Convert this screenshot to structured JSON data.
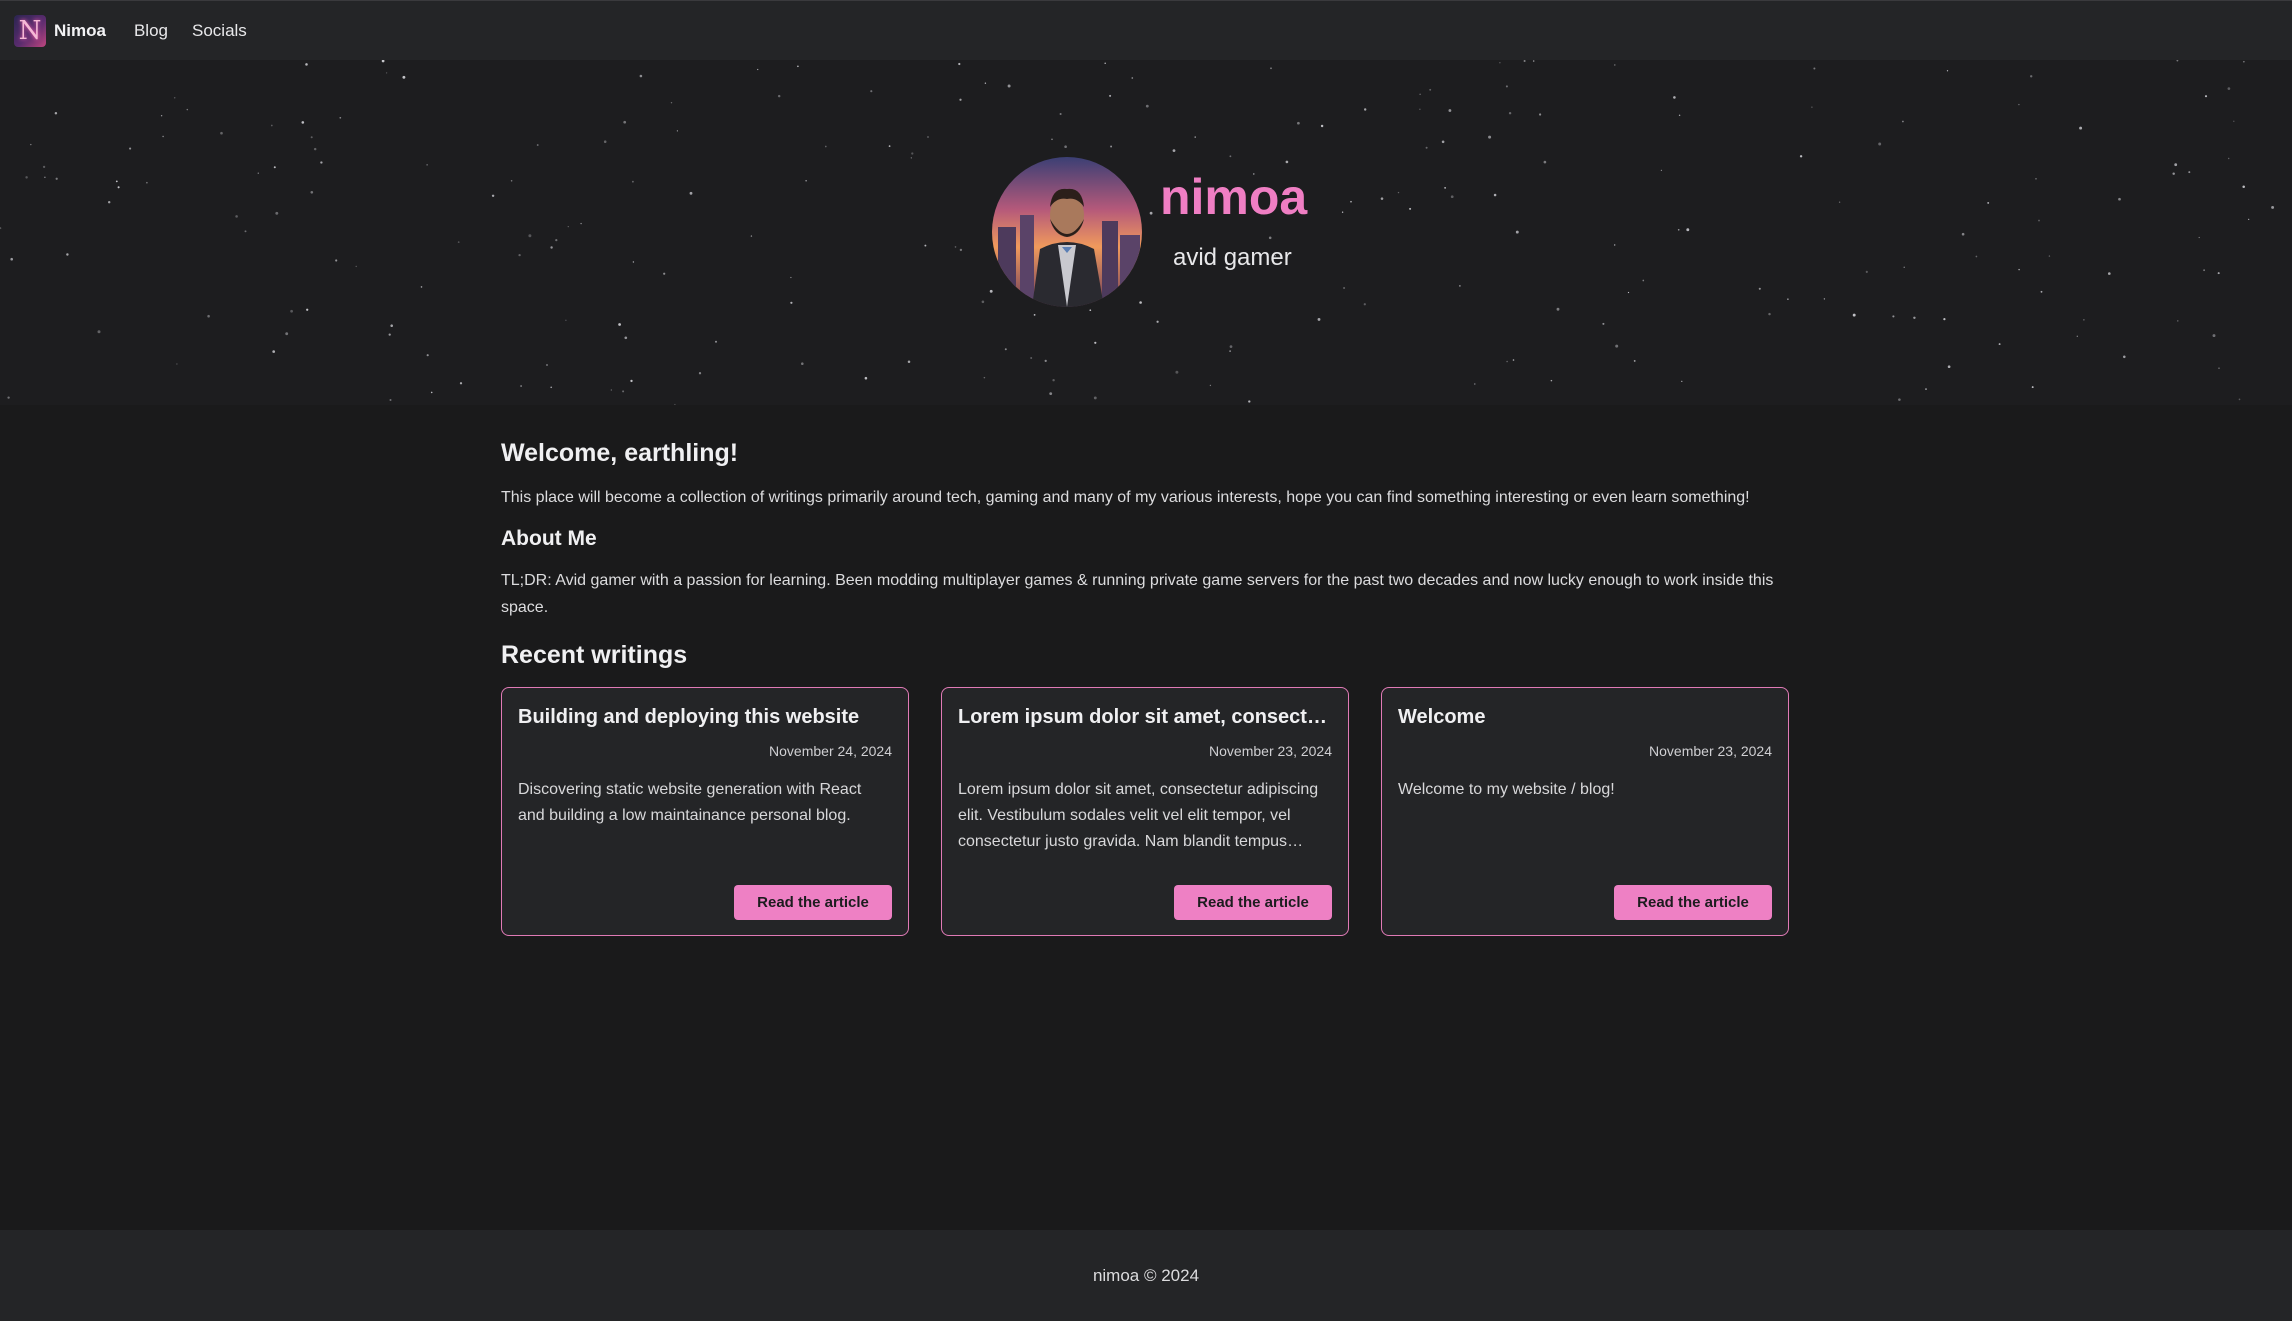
{
  "nav": {
    "brand": "Nimoa",
    "links": [
      "Blog",
      "Socials"
    ]
  },
  "hero": {
    "name": "nimoa",
    "tagline": "avid gamer"
  },
  "main": {
    "welcome_heading": "Welcome, earthling!",
    "welcome_text": "This place will become a collection of writings primarily around tech, gaming and many of my various interests, hope you can find something interesting or even learn something!",
    "about_heading": "About Me",
    "about_text": "TL;DR: Avid gamer with a passion for learning. Been modding multiplayer games & running private game servers for the past two decades and now lucky enough to work inside this space.",
    "recent_heading": "Recent writings"
  },
  "articles": [
    {
      "title": "Building and deploying this website",
      "date": "November 24, 2024",
      "description": "Discovering static website generation with React and building a low maintainance personal blog.",
      "button": "Read the article"
    },
    {
      "title": "Lorem ipsum dolor sit amet, consectetur adipiscing elit",
      "date": "November 23, 2024",
      "description": "Lorem ipsum dolor sit amet, consectetur adipiscing elit. Vestibulum sodales velit vel elit tempor, vel consectetur justo gravida. Nam blandit tempus lorem, vitae facilisis nibh.",
      "button": "Read the article"
    },
    {
      "title": "Welcome",
      "date": "November 23, 2024",
      "description": "Welcome to my website / blog!",
      "button": "Read the article"
    }
  ],
  "footer": {
    "text": "nimoa © 2024"
  },
  "colors": {
    "accent": "#ee80c4",
    "background": "#1a1a1b",
    "surface": "#242527"
  }
}
